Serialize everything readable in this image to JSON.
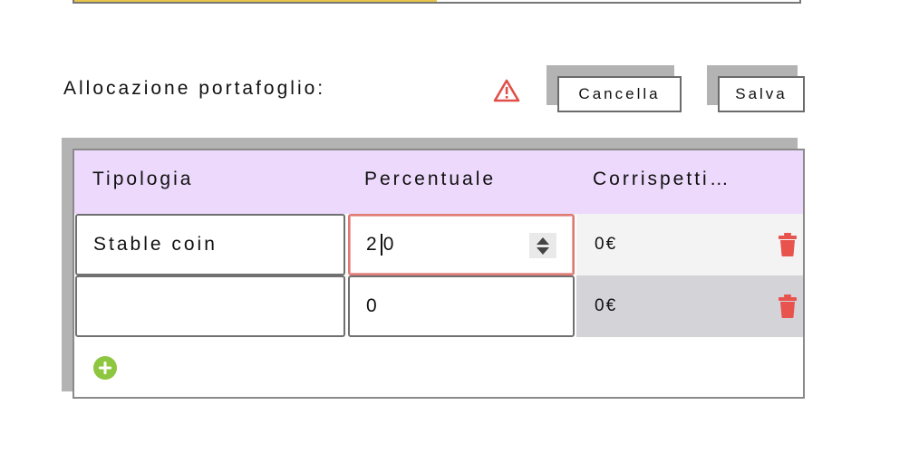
{
  "progress": {
    "fill_fraction": 0.5,
    "fill_color": "#e6c548"
  },
  "section": {
    "label": "Allocazione portafoglio:",
    "warning_icon": "warning-triangle-icon",
    "warning_color": "#e0504a"
  },
  "actions": {
    "cancel_label": "Cancella",
    "save_label": "Salva"
  },
  "table": {
    "header_color": "#ecd9fb",
    "columns": [
      "Tipologia",
      "Percentuale",
      "Corrispetti…"
    ],
    "rows": [
      {
        "tipologia": "",
        "tipologia_value": "Stable coin",
        "percent_before_caret": "2",
        "percent_after_caret": "0",
        "amount": "0€",
        "row_color": "#f3f3f3"
      },
      {
        "tipologia": "",
        "tipologia_value": "",
        "percent_before_caret": "0",
        "percent_after_caret": "",
        "amount": "0€",
        "row_color": "#d4d3d8"
      }
    ],
    "delete_icon": "trash-icon",
    "delete_color": "#e8534d",
    "add_icon": "plus-circle-icon",
    "add_color": "#8dc63f"
  }
}
